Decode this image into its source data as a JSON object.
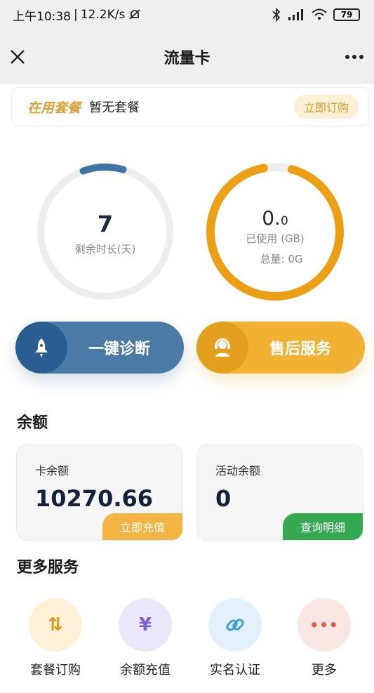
{
  "status_bar": {
    "time": "上午10:38",
    "speed": "12.2K/s",
    "battery": "79"
  },
  "nav": {
    "title": "流量卡"
  },
  "plan": {
    "label": "在用套餐",
    "value": "暂无套餐",
    "button": "立即订购"
  },
  "rings": {
    "days": {
      "value": "7",
      "label": "剩余时长(天)",
      "progress": 0.1
    },
    "data": {
      "value_main": "0.",
      "value_decimal": "0",
      "label": "已使用 (GB)",
      "total": "总量: 0G",
      "progress": 0.93
    }
  },
  "actions": {
    "diagnose": "一键诊断",
    "service": "售后服务"
  },
  "balance": {
    "title": "余额",
    "card": {
      "label": "卡余额",
      "amount": "10270.66",
      "button": "立即充值"
    },
    "activity": {
      "label": "活动余额",
      "amount": "0",
      "button": "查询明细"
    }
  },
  "more": {
    "title": "更多服务",
    "items": [
      {
        "label": "套餐订购",
        "glyph": "⇅"
      },
      {
        "label": "余额充值",
        "glyph": "¥"
      },
      {
        "label": "实名认证",
        "glyph": "🔗"
      },
      {
        "label": "更多",
        "glyph": "•••"
      }
    ]
  },
  "colors": {
    "accent_blue": "#2a5e92",
    "accent_orange": "#f1b233",
    "green": "#35a852",
    "purple": "#7b63d6"
  }
}
